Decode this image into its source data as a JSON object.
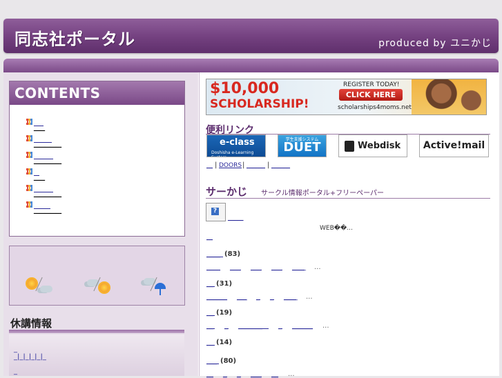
{
  "header": {
    "title": "同志社ポータル",
    "producer": "produced by ユニかじ"
  },
  "contents": {
    "title": "CONTENTS",
    "items": [
      "__",
      "_____",
      "_____",
      "__",
      "_____",
      "_____"
    ]
  },
  "kyuko": {
    "title": "休講情報",
    "line1": "_",
    "line2": "_|_|_|_|_|_",
    "line3": "_"
  },
  "banner": {
    "amount": "$10,000",
    "word": "SCHOLARSHIP!",
    "register": "REGISTER TODAY!",
    "button": "CLICK HERE",
    "url": "scholarships4moms.net"
  },
  "links_section": {
    "title": "便利リンク",
    "logos": [
      "e-class",
      "DUET",
      "Webdisk",
      "Active!mail"
    ],
    "eclass_sub": "Doshisha e-Learning System",
    "duet_sub": "学生支援システム",
    "nav": [
      "__",
      "DOORS",
      "______",
      "______"
    ]
  },
  "circle_section": {
    "title": "サーかじ",
    "subtitle": "サークル情報ポータル+フリーペーパー",
    "icon": "?",
    "link1": "_____",
    "web_text": "WEB��...",
    "link2": "__",
    "categories": [
      {
        "name": "____",
        "count": "(83)",
        "items": [
          "____",
          "___",
          "___",
          "___",
          "____"
        ],
        "more": "..."
      },
      {
        "name": "__",
        "count": "(31)",
        "items": [
          "______",
          "___",
          "_",
          "_",
          "____"
        ],
        "more": "..."
      },
      {
        "name": "__",
        "count": "(19)",
        "items": [
          "__",
          "_",
          "_______",
          "_",
          "______"
        ],
        "more": "..."
      },
      {
        "name": "__",
        "count": "(14)",
        "items": [],
        "more": ""
      },
      {
        "name": "___",
        "count": "(80)",
        "items": [
          "__",
          "_",
          "_",
          "___",
          "__"
        ],
        "more": "..."
      }
    ]
  }
}
